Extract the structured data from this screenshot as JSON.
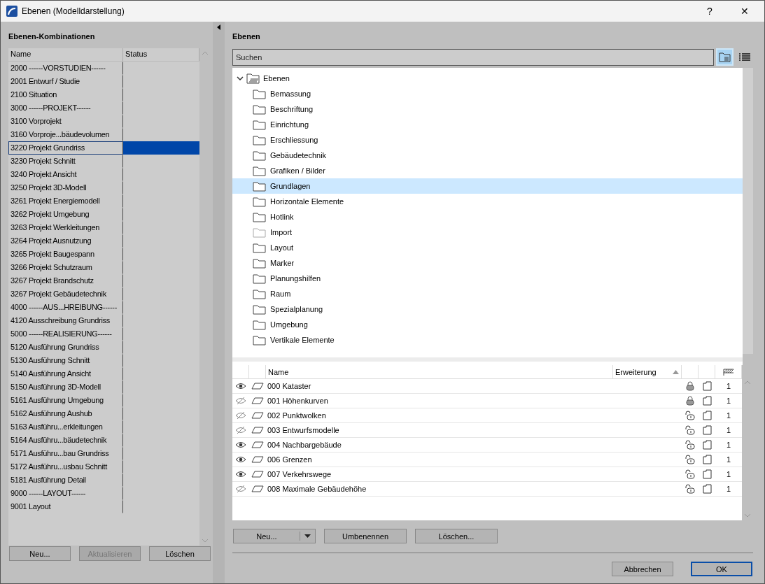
{
  "window": {
    "title": "Ebenen (Modelldarstellung)",
    "help": "?",
    "close": "✕"
  },
  "combinations": {
    "title": "Ebenen-Kombinationen",
    "columns": [
      "Name",
      "Status"
    ],
    "rows": [
      {
        "name": "2000 ------VORSTUDIEN------",
        "selected": false
      },
      {
        "name": "2001 Entwurf / Studie",
        "selected": false
      },
      {
        "name": "2100 Situation",
        "selected": false
      },
      {
        "name": "3000 ------PROJEKT------",
        "selected": false
      },
      {
        "name": "3100 Vorprojekt",
        "selected": false
      },
      {
        "name": "3160 Vorproje...bäudevolumen",
        "selected": false
      },
      {
        "name": "3220 Projekt Grundriss",
        "selected": true
      },
      {
        "name": "3230 Projekt Schnitt",
        "selected": false
      },
      {
        "name": "3240 Projekt Ansicht",
        "selected": false
      },
      {
        "name": "3250 Projekt 3D-Modell",
        "selected": false
      },
      {
        "name": "3261 Projekt Energiemodell",
        "selected": false
      },
      {
        "name": "3262 Projekt Umgebung",
        "selected": false
      },
      {
        "name": "3263 Projekt Werkleitungen",
        "selected": false
      },
      {
        "name": "3264 Projekt Ausnutzung",
        "selected": false
      },
      {
        "name": "3265 Projekt Baugespann",
        "selected": false
      },
      {
        "name": "3266 Projekt Schutzraum",
        "selected": false
      },
      {
        "name": "3267 Projekt Brandschutz",
        "selected": false
      },
      {
        "name": "3267 Projekt Gebäudetechnik",
        "selected": false
      },
      {
        "name": "4000 ------AUS...HREIBUNG------",
        "selected": false
      },
      {
        "name": "4120 Ausschreibung Grundriss",
        "selected": false
      },
      {
        "name": "5000 ------REALISIERUNG------",
        "selected": false
      },
      {
        "name": "5120 Ausführung Grundriss",
        "selected": false
      },
      {
        "name": "5130 Ausführung Schnitt",
        "selected": false
      },
      {
        "name": "5140 Ausführung Ansicht",
        "selected": false
      },
      {
        "name": "5150 Ausführung 3D-Modell",
        "selected": false
      },
      {
        "name": "5161 Ausführung Umgebung",
        "selected": false
      },
      {
        "name": "5162 Ausführung Aushub",
        "selected": false
      },
      {
        "name": "5163 Ausführu...erkleitungen",
        "selected": false
      },
      {
        "name": "5164 Ausführu...bäudetechnik",
        "selected": false
      },
      {
        "name": "5171 Ausführu...bau Grundriss",
        "selected": false
      },
      {
        "name": "5172 Ausführu...usbau Schnitt",
        "selected": false
      },
      {
        "name": "5181 Ausführung Detail",
        "selected": false
      },
      {
        "name": "9000 ------LAYOUT------",
        "selected": false
      },
      {
        "name": "9001 Layout",
        "selected": false
      }
    ],
    "buttons": [
      {
        "label": "Neu...",
        "disabled": false
      },
      {
        "label": "Aktualisieren",
        "disabled": true
      },
      {
        "label": "Löschen",
        "disabled": false
      }
    ]
  },
  "layers": {
    "title": "Ebenen",
    "search": {
      "placeholder": "Suchen"
    },
    "tree": {
      "label": "Ebenen",
      "expanded": true,
      "children": [
        {
          "label": "Bemassung",
          "selected": false,
          "empty": false
        },
        {
          "label": "Beschriftung",
          "selected": false,
          "empty": false
        },
        {
          "label": "Einrichtung",
          "selected": false,
          "empty": false
        },
        {
          "label": "Erschliessung",
          "selected": false,
          "empty": false
        },
        {
          "label": "Gebäudetechnik",
          "selected": false,
          "empty": false
        },
        {
          "label": "Grafiken / Bilder",
          "selected": false,
          "empty": false
        },
        {
          "label": "Grundlagen",
          "selected": true,
          "empty": false
        },
        {
          "label": "Horizontale Elemente",
          "selected": false,
          "empty": false
        },
        {
          "label": "Hotlink",
          "selected": false,
          "empty": false
        },
        {
          "label": "Import",
          "selected": false,
          "empty": true
        },
        {
          "label": "Layout",
          "selected": false,
          "empty": false
        },
        {
          "label": "Marker",
          "selected": false,
          "empty": false
        },
        {
          "label": "Planungshilfen",
          "selected": false,
          "empty": false
        },
        {
          "label": "Raum",
          "selected": false,
          "empty": false
        },
        {
          "label": "Spezialplanung",
          "selected": false,
          "empty": false
        },
        {
          "label": "Umgebung",
          "selected": false,
          "empty": false
        },
        {
          "label": "Vertikale Elemente",
          "selected": false,
          "empty": false
        }
      ]
    },
    "table": {
      "columns": [
        "Name",
        "Erweiterung"
      ],
      "rows": [
        {
          "name": "000 Kataster",
          "visible": true,
          "locked": true,
          "count": "1"
        },
        {
          "name": "001 Höhenkurven",
          "visible": false,
          "locked": true,
          "count": "1"
        },
        {
          "name": "002 Punktwolken",
          "visible": false,
          "locked": false,
          "count": "1"
        },
        {
          "name": "003 Entwurfsmodelle",
          "visible": false,
          "locked": false,
          "count": "1"
        },
        {
          "name": "004 Nachbargebäude",
          "visible": true,
          "locked": false,
          "count": "1"
        },
        {
          "name": "006 Grenzen",
          "visible": true,
          "locked": false,
          "count": "1"
        },
        {
          "name": "007 Verkehrswege",
          "visible": true,
          "locked": false,
          "count": "1"
        },
        {
          "name": "008 Maximale Gebäudehöhe",
          "visible": false,
          "locked": false,
          "count": "1"
        }
      ]
    },
    "buttons": [
      "Neu...",
      "Umbenennen",
      "Löschen..."
    ]
  },
  "footer": {
    "buttons": [
      {
        "label": "Abbrechen",
        "default": false
      },
      {
        "label": "OK",
        "default": true
      }
    ]
  }
}
